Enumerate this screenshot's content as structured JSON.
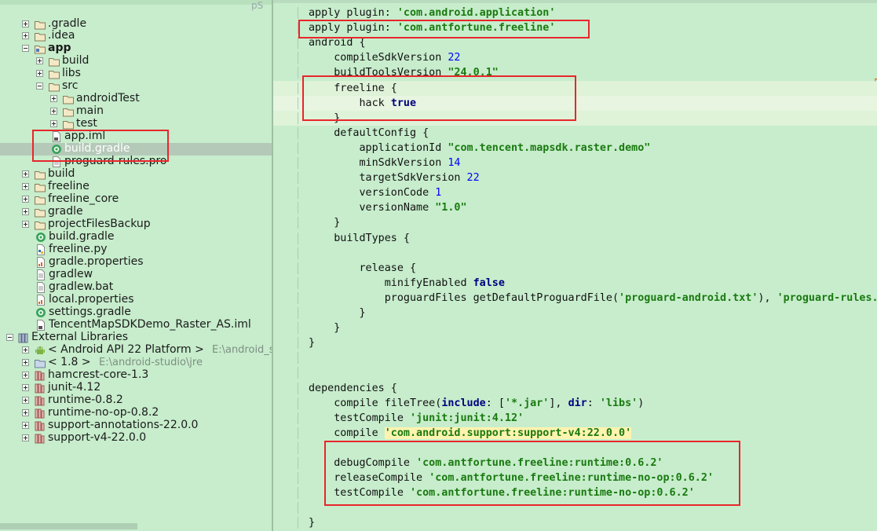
{
  "tree": {
    "clipped_label": "pS",
    "items": [
      {
        "label": ".gradle",
        "icon": "folder-icon",
        "toggle": "plus"
      },
      {
        "label": ".idea",
        "icon": "folder-icon",
        "toggle": "plus"
      },
      {
        "label": "app",
        "icon": "module-folder-icon",
        "toggle": "minus",
        "bold": true
      },
      {
        "label": "build",
        "icon": "folder-icon",
        "toggle": "plus"
      },
      {
        "label": "libs",
        "icon": "folder-icon",
        "toggle": "plus"
      },
      {
        "label": "src",
        "icon": "folder-icon",
        "toggle": "minus"
      },
      {
        "label": "androidTest",
        "icon": "folder-icon",
        "toggle": "plus"
      },
      {
        "label": "main",
        "icon": "folder-icon",
        "toggle": "plus"
      },
      {
        "label": "test",
        "icon": "folder-icon",
        "toggle": "plus"
      },
      {
        "label": "app.iml",
        "icon": "iml-file-icon"
      },
      {
        "label": "build.gradle",
        "icon": "gradle-file-icon",
        "selected": true
      },
      {
        "label": "proguard-rules.pro",
        "icon": "text-file-icon"
      },
      {
        "label": "build",
        "icon": "folder-icon",
        "toggle": "plus"
      },
      {
        "label": "freeline",
        "icon": "folder-icon",
        "toggle": "plus"
      },
      {
        "label": "freeline_core",
        "icon": "folder-icon",
        "toggle": "plus"
      },
      {
        "label": "gradle",
        "icon": "folder-icon",
        "toggle": "plus"
      },
      {
        "label": "projectFilesBackup",
        "icon": "folder-icon",
        "toggle": "plus"
      },
      {
        "label": "build.gradle",
        "icon": "gradle-file-icon"
      },
      {
        "label": "freeline.py",
        "icon": "python-file-icon"
      },
      {
        "label": "gradle.properties",
        "icon": "properties-file-icon"
      },
      {
        "label": "gradlew",
        "icon": "text-file-icon"
      },
      {
        "label": "gradlew.bat",
        "icon": "text-file-icon"
      },
      {
        "label": "local.properties",
        "icon": "properties-file-icon"
      },
      {
        "label": "settings.gradle",
        "icon": "gradle-file-icon"
      },
      {
        "label": "TencentMapSDKDemo_Raster_AS.iml",
        "icon": "iml-file-icon"
      },
      {
        "label": "External Libraries",
        "icon": "library-stack-icon",
        "toggle": "minus"
      },
      {
        "label": "< Android API 22 Platform >",
        "hint": "E:\\android_s",
        "icon": "android-icon",
        "toggle": "plus"
      },
      {
        "label": "< 1.8 >",
        "hint": "E:\\android-studio\\jre",
        "icon": "jdk-folder-icon",
        "toggle": "plus"
      },
      {
        "label": "hamcrest-core-1.3",
        "icon": "library-icon",
        "toggle": "plus"
      },
      {
        "label": "junit-4.12",
        "icon": "library-icon",
        "toggle": "plus"
      },
      {
        "label": "runtime-0.8.2",
        "icon": "library-icon",
        "toggle": "plus"
      },
      {
        "label": "runtime-no-op-0.8.2",
        "icon": "library-icon",
        "toggle": "plus"
      },
      {
        "label": "support-annotations-22.0.0",
        "icon": "library-icon",
        "toggle": "plus"
      },
      {
        "label": "support-v4-22.0.0",
        "icon": "library-icon",
        "toggle": "plus"
      }
    ]
  },
  "code": [
    [
      {
        "t": "apply plugin: "
      },
      {
        "t": "'com.android.application'",
        "c": "s"
      }
    ],
    [
      {
        "t": "apply plugin: "
      },
      {
        "t": "'com.antfortune.freeline'",
        "c": "s"
      }
    ],
    [
      {
        "t": "android {"
      }
    ],
    [
      {
        "t": "    compileSdkVersion "
      },
      {
        "t": "22",
        "c": "n"
      }
    ],
    [
      {
        "t": "    buildToolsVersion "
      },
      {
        "t": "\"24.0.1\"",
        "c": "s"
      }
    ],
    [
      {
        "t": "    freeline {"
      }
    ],
    [
      {
        "t": "        hack "
      },
      {
        "t": "true",
        "c": "k"
      }
    ],
    [
      {
        "t": "    }"
      }
    ],
    [
      {
        "t": "    defaultConfig {"
      }
    ],
    [
      {
        "t": "        applicationId "
      },
      {
        "t": "\"com.tencent.mapsdk.raster.demo\"",
        "c": "s"
      }
    ],
    [
      {
        "t": "        minSdkVersion "
      },
      {
        "t": "14",
        "c": "n"
      }
    ],
    [
      {
        "t": "        targetSdkVersion "
      },
      {
        "t": "22",
        "c": "n"
      }
    ],
    [
      {
        "t": "        versionCode "
      },
      {
        "t": "1",
        "c": "n"
      }
    ],
    [
      {
        "t": "        versionName "
      },
      {
        "t": "\"1.0\"",
        "c": "s"
      }
    ],
    [
      {
        "t": "    }"
      }
    ],
    [
      {
        "t": "    buildTypes {"
      }
    ],
    [],
    [
      {
        "t": "        release {"
      }
    ],
    [
      {
        "t": "            minifyEnabled "
      },
      {
        "t": "false",
        "c": "k"
      }
    ],
    [
      {
        "t": "            proguardFiles getDefaultProguardFile("
      },
      {
        "t": "'proguard-android.txt'",
        "c": "s"
      },
      {
        "t": "), "
      },
      {
        "t": "'proguard-rules.p",
        "c": "s"
      }
    ],
    [
      {
        "t": "        }"
      }
    ],
    [
      {
        "t": "    }"
      }
    ],
    [
      {
        "t": "}"
      }
    ],
    [],
    [],
    [
      {
        "t": "dependencies {"
      }
    ],
    [
      {
        "t": "    compile fileTree("
      },
      {
        "t": "include",
        "c": "k"
      },
      {
        "t": ": ["
      },
      {
        "t": "'*.jar'",
        "c": "s"
      },
      {
        "t": "], "
      },
      {
        "t": "dir",
        "c": "k"
      },
      {
        "t": ": "
      },
      {
        "t": "'libs'",
        "c": "s"
      },
      {
        "t": ")"
      }
    ],
    [
      {
        "t": "    testCompile "
      },
      {
        "t": "'junit:junit:4.12'",
        "c": "s"
      }
    ],
    [
      {
        "t": "    compile "
      },
      {
        "t": "'com.android.support:support-v4:22.0.0'",
        "c": "s h"
      }
    ],
    [],
    [
      {
        "t": "    debugCompile "
      },
      {
        "t": "'com.antfortune.freeline:runtime:0.6.2'",
        "c": "s"
      }
    ],
    [
      {
        "t": "    releaseCompile "
      },
      {
        "t": "'com.antfortune.freeline:runtime-no-op:0.6.2'",
        "c": "s"
      }
    ],
    [
      {
        "t": "    testCompile "
      },
      {
        "t": "'com.antfortune.freeline:runtime-no-op:0.6.2'",
        "c": "s"
      }
    ],
    [],
    [
      {
        "t": "}"
      }
    ]
  ],
  "colors": {
    "background": "#c7edcc",
    "annotation_red": "#e8262c",
    "string": "#1a7a10",
    "keyword": "#00007f",
    "number": "#0000ff"
  }
}
